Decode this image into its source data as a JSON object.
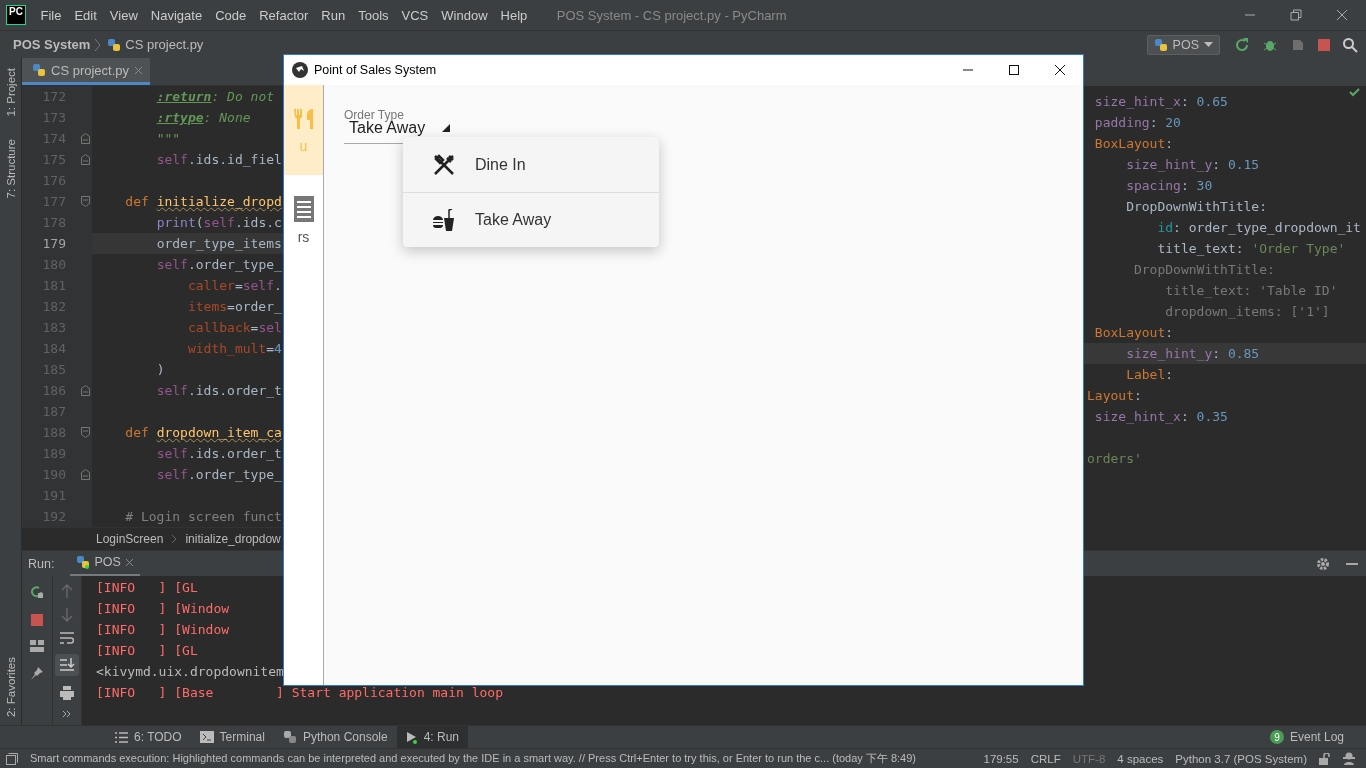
{
  "menu_bar": {
    "logo": "PC",
    "items": [
      "File",
      "Edit",
      "View",
      "Navigate",
      "Code",
      "Refactor",
      "Run",
      "Tools",
      "VCS",
      "Window",
      "Help"
    ],
    "title": "POS System - CS project.py - PyCharm"
  },
  "navigation_bar": {
    "project": "POS System",
    "file": "CS project.py",
    "run_config": "POS"
  },
  "side_tool_tabs": [
    "1: Project",
    "7: Structure"
  ],
  "favorites_tab": "2: Favorites",
  "editor": {
    "tabs": [
      {
        "label": "CS project.py",
        "selected": true
      }
    ],
    "lines": [
      {
        "number": "172",
        "current": false,
        "fold_start": false,
        "fold_end": false,
        "code": [
          {
            "text": "        :return",
            "kind": "doctag"
          },
          {
            "text": ": Do not",
            "kind": "doc"
          }
        ]
      },
      {
        "number": "173",
        "current": false,
        "fold_start": false,
        "fold_end": false,
        "code": [
          {
            "text": "        :rtype",
            "kind": "doctag"
          },
          {
            "text": ": None",
            "kind": "doc"
          }
        ]
      },
      {
        "number": "174",
        "current": false,
        "fold_start": false,
        "fold_end": true,
        "code": [
          {
            "text": "        \"\"\"",
            "kind": "doc"
          }
        ]
      },
      {
        "number": "175",
        "current": false,
        "fold_start": false,
        "fold_end": true,
        "code": [
          {
            "text": "        self",
            "kind": "self"
          },
          {
            "text": ".ids.id_fiel",
            "kind": "plain"
          }
        ]
      },
      {
        "number": "176",
        "current": false,
        "fold_start": false,
        "fold_end": false
      },
      {
        "number": "177",
        "current": false,
        "fold_start": true,
        "fold_end": false,
        "code": [
          {
            "text": "    def ",
            "kind": "keyword"
          },
          {
            "text": "initialize_dropd",
            "kind": "function"
          }
        ]
      },
      {
        "number": "178",
        "current": false,
        "fold_start": false,
        "fold_end": false,
        "code": [
          {
            "text": "        print",
            "kind": "builtin"
          },
          {
            "text": "(",
            "kind": "plain"
          },
          {
            "text": "self",
            "kind": "self"
          },
          {
            "text": ".ids.c",
            "kind": "plain"
          }
        ]
      },
      {
        "number": "179",
        "current": true,
        "fold_start": false,
        "fold_end": false,
        "code": [
          {
            "text": "        order_type_items",
            "kind": "plain"
          }
        ]
      },
      {
        "number": "180",
        "current": false,
        "fold_start": false,
        "fold_end": false,
        "code": [
          {
            "text": "        self",
            "kind": "self"
          },
          {
            "text": ".order_type_",
            "kind": "plain"
          }
        ]
      },
      {
        "number": "181",
        "current": false,
        "fold_start": false,
        "fold_end": false,
        "code": [
          {
            "text": "            caller",
            "kind": "param"
          },
          {
            "text": "=",
            "kind": "plain"
          },
          {
            "text": "self",
            "kind": "self"
          },
          {
            "text": ".",
            "kind": "plain"
          }
        ]
      },
      {
        "number": "182",
        "current": false,
        "fold_start": false,
        "fold_end": false,
        "code": [
          {
            "text": "            items",
            "kind": "param"
          },
          {
            "text": "=order_",
            "kind": "plain"
          }
        ]
      },
      {
        "number": "183",
        "current": false,
        "fold_start": false,
        "fold_end": false,
        "code": [
          {
            "text": "            callback",
            "kind": "param"
          },
          {
            "text": "=",
            "kind": "plain"
          },
          {
            "text": "sel",
            "kind": "self"
          }
        ]
      },
      {
        "number": "184",
        "current": false,
        "fold_start": false,
        "fold_end": false,
        "code": [
          {
            "text": "            width_mult",
            "kind": "param"
          },
          {
            "text": "=",
            "kind": "plain"
          },
          {
            "text": "4",
            "kind": "number"
          }
        ]
      },
      {
        "number": "185",
        "current": false,
        "fold_start": false,
        "fold_end": false,
        "code": [
          {
            "text": "        )",
            "kind": "plain"
          }
        ]
      },
      {
        "number": "186",
        "current": false,
        "fold_start": false,
        "fold_end": true,
        "code": [
          {
            "text": "        self",
            "kind": "self"
          },
          {
            "text": ".ids.order_t",
            "kind": "plain"
          }
        ]
      },
      {
        "number": "187",
        "current": false,
        "fold_start": false,
        "fold_end": false
      },
      {
        "number": "188",
        "current": false,
        "fold_start": true,
        "fold_end": false,
        "code": [
          {
            "text": "    def ",
            "kind": "keyword"
          },
          {
            "text": "dropdown_item_ca",
            "kind": "function"
          }
        ]
      },
      {
        "number": "189",
        "current": false,
        "fold_start": false,
        "fold_end": false,
        "code": [
          {
            "text": "        self",
            "kind": "self"
          },
          {
            "text": ".ids.order_t",
            "kind": "plain"
          }
        ]
      },
      {
        "number": "190",
        "current": false,
        "fold_start": false,
        "fold_end": true,
        "code": [
          {
            "text": "        self",
            "kind": "self"
          },
          {
            "text": ".order_type_",
            "kind": "plain"
          }
        ]
      },
      {
        "number": "191",
        "current": false,
        "fold_start": false,
        "fold_end": false
      },
      {
        "number": "192",
        "current": false,
        "fold_start": false,
        "fold_end": false,
        "code": [
          {
            "text": "    # Login screen funct",
            "kind": "comment"
          }
        ]
      }
    ],
    "breadcrumb": [
      "LoginScreen",
      "initialize_dropdow"
    ]
  },
  "kv_editor": {
    "lines": [
      {
        "current": false,
        "code": [
          {
            "text": " size_hint_x",
            "kind": "prop"
          },
          {
            "text": ": ",
            "kind": "plain"
          },
          {
            "text": "0.65",
            "kind": "number"
          }
        ]
      },
      {
        "current": false,
        "code": [
          {
            "text": " padding",
            "kind": "prop"
          },
          {
            "text": ": ",
            "kind": "plain"
          },
          {
            "text": "20",
            "kind": "number"
          }
        ]
      },
      {
        "current": false,
        "code": [
          {
            "text": " BoxLayout",
            "kind": "widget"
          },
          {
            "text": ":",
            "kind": "plain"
          }
        ]
      },
      {
        "current": false,
        "code": [
          {
            "text": "     size_hint_y",
            "kind": "prop"
          },
          {
            "text": ": ",
            "kind": "plain"
          },
          {
            "text": "0.15",
            "kind": "number"
          }
        ]
      },
      {
        "current": false,
        "code": [
          {
            "text": "     spacing",
            "kind": "prop"
          },
          {
            "text": ": ",
            "kind": "plain"
          },
          {
            "text": "30",
            "kind": "number"
          }
        ]
      },
      {
        "current": false,
        "code": [
          {
            "text": "     DropDownWithTitle:",
            "kind": "plain"
          }
        ]
      },
      {
        "current": false,
        "code": [
          {
            "text": "         id",
            "kind": "idkey"
          },
          {
            "text": ": order_type_dropdown_it",
            "kind": "plain"
          }
        ]
      },
      {
        "current": false,
        "code": [
          {
            "text": "         title_text: ",
            "kind": "plain"
          },
          {
            "text": "'Order Type'",
            "kind": "string"
          }
        ]
      },
      {
        "current": false,
        "code": [
          {
            "text": "      DropDownWithTitle:",
            "kind": "muted"
          }
        ]
      },
      {
        "current": false,
        "code": [
          {
            "text": "          title_text: 'Table ID'",
            "kind": "muted"
          }
        ]
      },
      {
        "current": false,
        "code": [
          {
            "text": "          dropdown_items: ['1']",
            "kind": "muted"
          }
        ]
      },
      {
        "current": false,
        "code": [
          {
            "text": " BoxLayout",
            "kind": "widget"
          },
          {
            "text": ":",
            "kind": "plain"
          }
        ]
      },
      {
        "current": true,
        "code": [
          {
            "text": "     size_hint_y",
            "kind": "prop"
          },
          {
            "text": ": ",
            "kind": "plain"
          },
          {
            "text": "0.85",
            "kind": "number"
          }
        ]
      },
      {
        "current": false,
        "code": [
          {
            "text": "     Label",
            "kind": "widget"
          },
          {
            "text": ":",
            "kind": "plain"
          }
        ]
      },
      {
        "current": false,
        "code": [
          {
            "text": "Layout",
            "kind": "widget"
          },
          {
            "text": ":",
            "kind": "plain"
          }
        ]
      },
      {
        "current": false,
        "code": [
          {
            "text": " size_hint_x",
            "kind": "prop"
          },
          {
            "text": ": ",
            "kind": "plain"
          },
          {
            "text": "0.35",
            "kind": "number"
          }
        ]
      },
      {
        "current": false
      },
      {
        "current": false,
        "code": [
          {
            "text": "orders'",
            "kind": "string"
          }
        ]
      }
    ]
  },
  "app_window": {
    "title": "Point of Sales System",
    "nav_rail": [
      {
        "label": "u",
        "selected": true
      },
      {
        "label": "rs",
        "selected": false
      }
    ],
    "order_type": {
      "label": "Order Type",
      "value": "Take Away"
    },
    "dropdown": [
      "Dine In",
      "Take Away"
    ]
  },
  "run_panel": {
    "label": "Run:",
    "tabs": [
      {
        "label": "POS",
        "selected": true
      }
    ],
    "console": [
      {
        "text": "[INFO   ] [GL",
        "kind": "stderr"
      },
      {
        "text": "[INFO   ] [Window",
        "kind": "stderr"
      },
      {
        "text": "[INFO   ] [Window",
        "kind": "stderr"
      },
      {
        "text": "[INFO   ] [GL",
        "kind": "stderr"
      },
      {
        "text": "<kivymd.uix.dropdownitem",
        "kind": "stdout"
      },
      {
        "text": "[INFO   ] [Base        ] Start application main loop",
        "kind": "stderr"
      }
    ]
  },
  "tool_tabs": [
    {
      "label": "6: TODO",
      "selected": false
    },
    {
      "label": "Terminal",
      "selected": false
    },
    {
      "label": "Python Console",
      "selected": false
    },
    {
      "label": "4: Run",
      "selected": true
    }
  ],
  "event_log": {
    "count": "9",
    "label": "Event Log"
  },
  "status_bar": {
    "message": "Smart commands execution: Highlighted commands can be interpreted and executed by the IDE in a smart way. // Press Ctrl+Enter to try this, or Enter to run the c... (today 下午 8:49)",
    "items": [
      {
        "text": "179:55",
        "disabled": false
      },
      {
        "text": "CRLF",
        "disabled": false
      },
      {
        "text": "UTF-8",
        "disabled": true
      },
      {
        "text": "4 spaces",
        "disabled": false
      },
      {
        "text": "Python 3.7 (POS System)",
        "disabled": false
      }
    ]
  }
}
